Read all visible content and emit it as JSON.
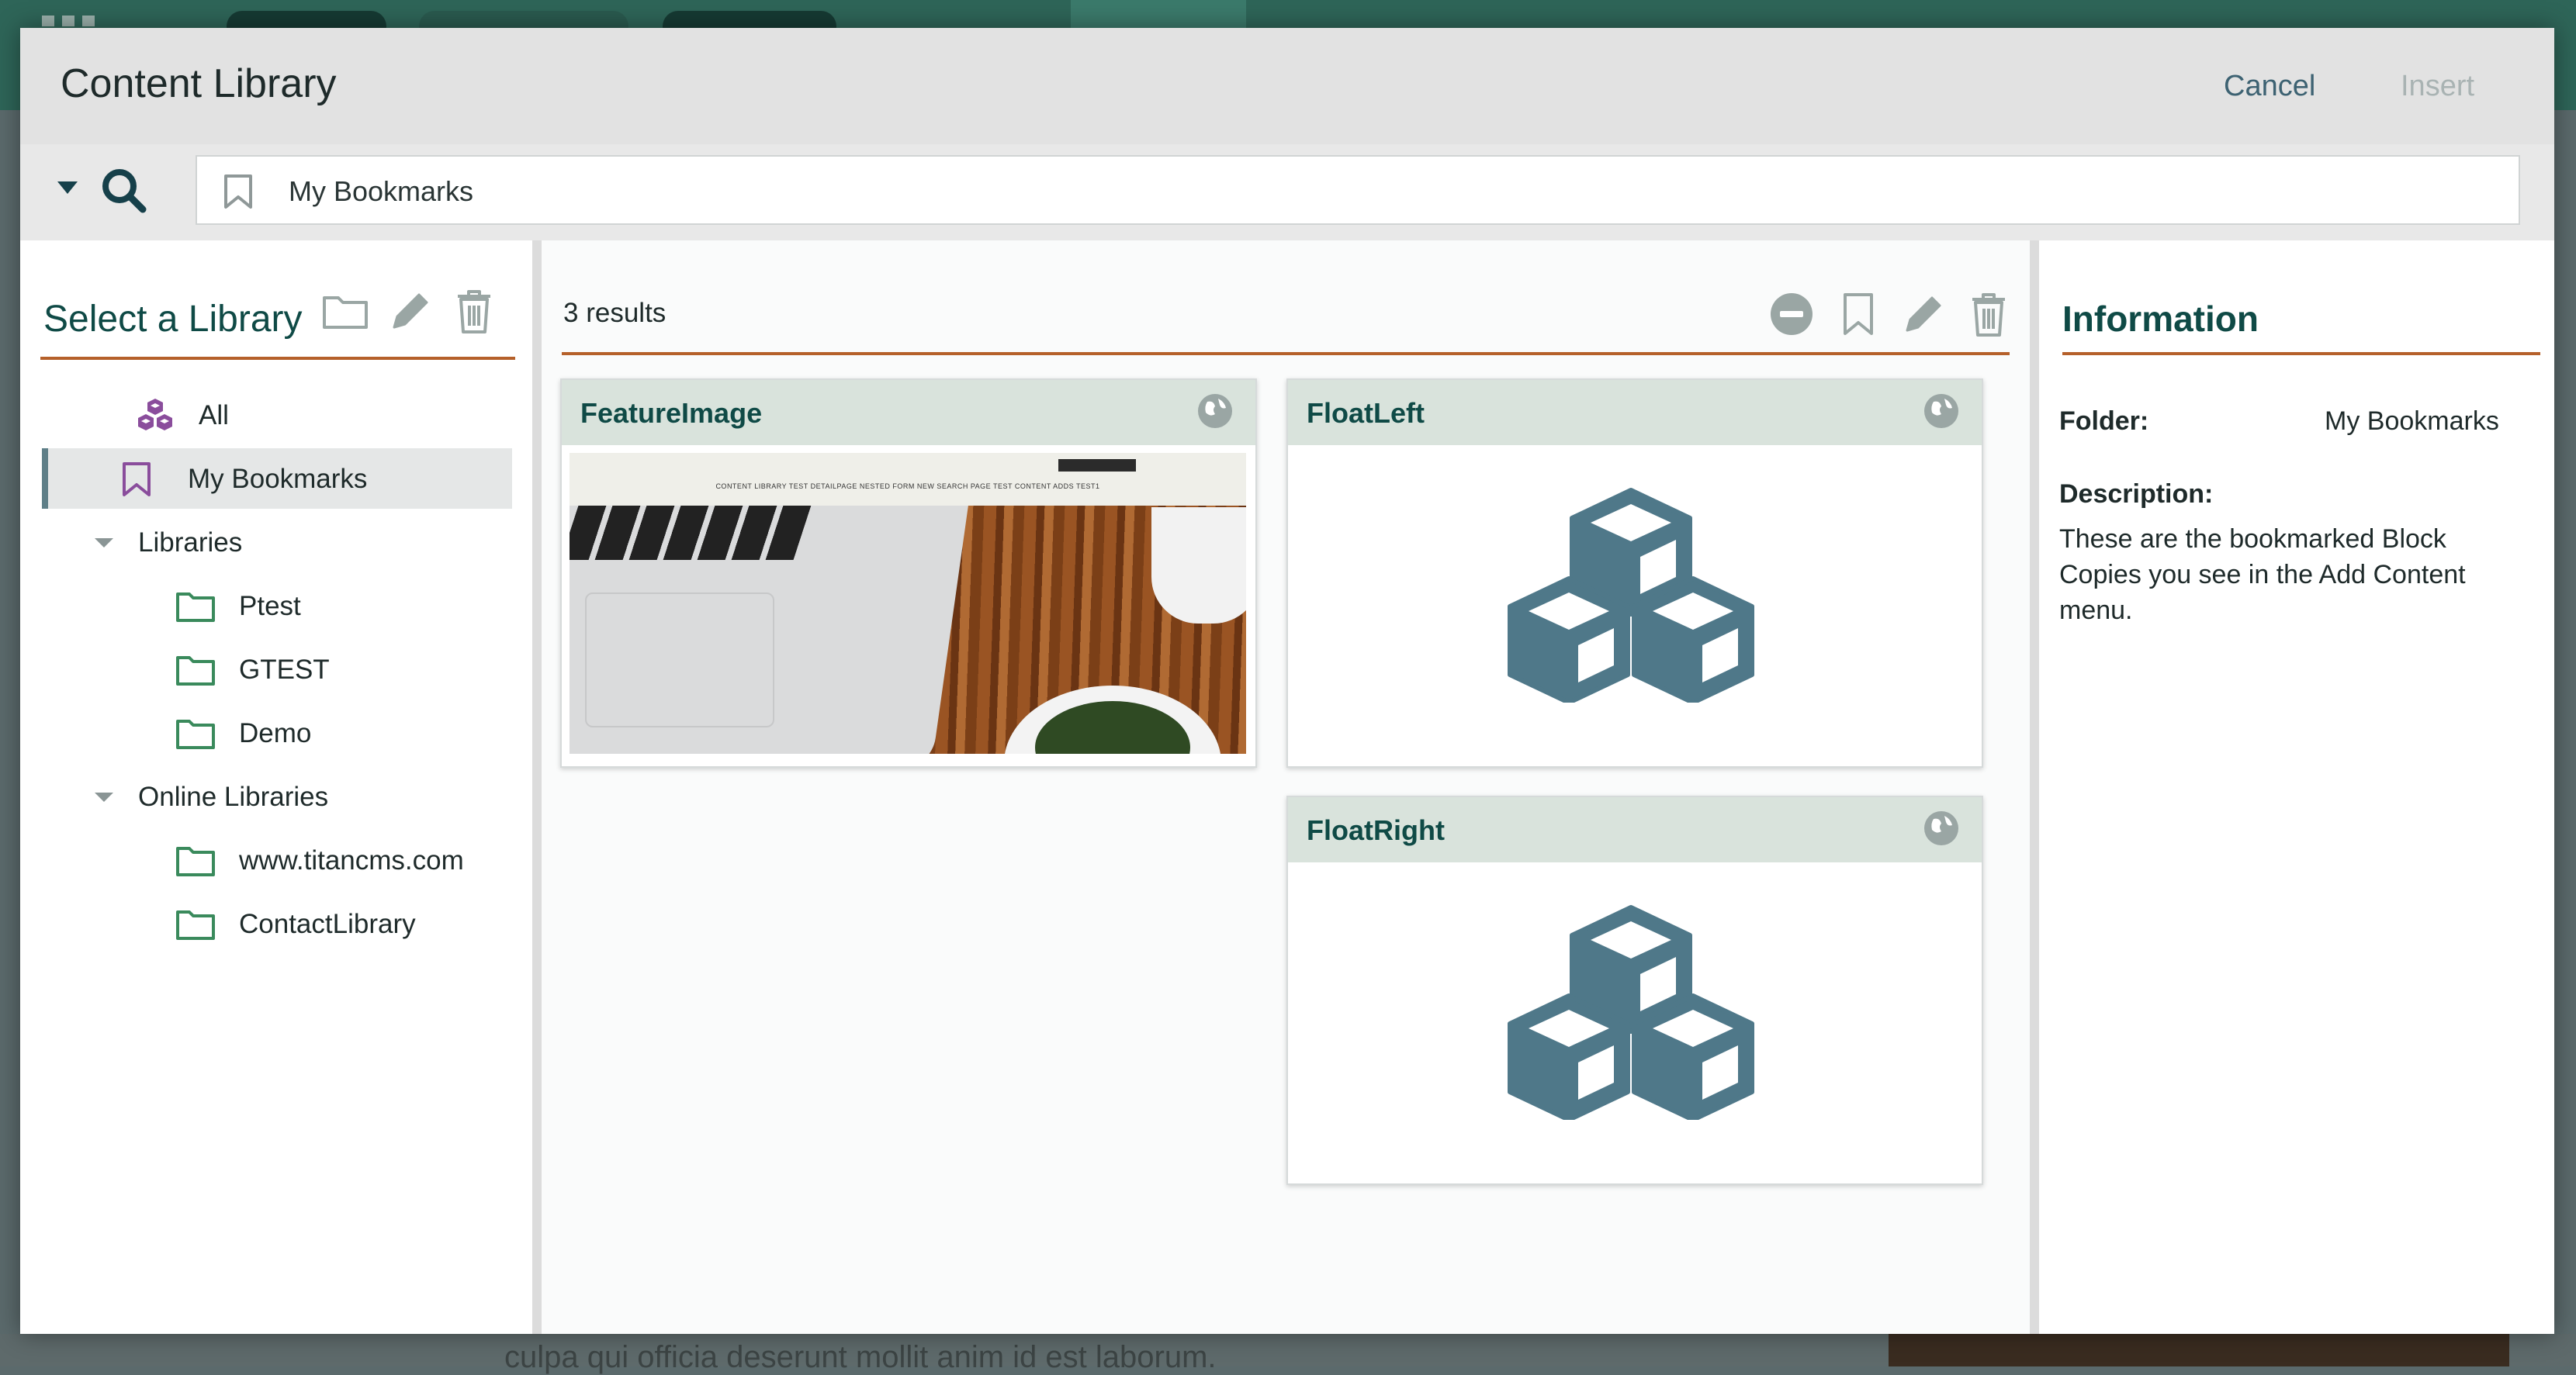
{
  "dialog": {
    "title": "Content Library",
    "cancel_label": "Cancel",
    "insert_label": "Insert"
  },
  "search": {
    "value": "My Bookmarks"
  },
  "libraries": {
    "title": "Select a Library",
    "items": [
      {
        "label": "All",
        "icon": "cubes-icon"
      },
      {
        "label": "My Bookmarks",
        "icon": "bookmark-icon",
        "selected": true
      },
      {
        "label": "Libraries",
        "icon": "caret-down-icon"
      },
      {
        "label": "Ptest",
        "icon": "folder-icon"
      },
      {
        "label": "GTEST",
        "icon": "folder-icon"
      },
      {
        "label": "Demo",
        "icon": "folder-icon"
      },
      {
        "label": "Online Libraries",
        "icon": "caret-down-icon"
      },
      {
        "label": "www.titancms.com",
        "icon": "folder-icon"
      },
      {
        "label": "ContactLibrary",
        "icon": "folder-icon"
      }
    ]
  },
  "results": {
    "count": "3",
    "count_suffix": "results",
    "cards": [
      {
        "title": "FeatureImage",
        "type": "image"
      },
      {
        "title": "FloatLeft",
        "type": "block"
      },
      {
        "title": "FloatRight",
        "type": "block"
      }
    ],
    "thumbnail_nav": "CONTENT LIBRARY TEST    DETAILPAGE    NESTED FORM    NEW    SEARCH PAGE    TEST CONTENT ADDS    TEST1"
  },
  "information": {
    "title": "Information",
    "folder_label": "Folder:",
    "folder_value": "My Bookmarks",
    "description_label": "Description:",
    "description_value": "These are the bookmarked Block Copies you see in the Add Content menu."
  },
  "background": {
    "footer_text": "culpa qui officia deserunt mollit anim id est laborum."
  },
  "colors": {
    "accent_orange": "#b5602a",
    "heading_green": "#0f4a46",
    "icon_green": "#3a8a5c",
    "cube_blue": "#4f7889",
    "bookmark_purple": "#8a4d9c"
  }
}
